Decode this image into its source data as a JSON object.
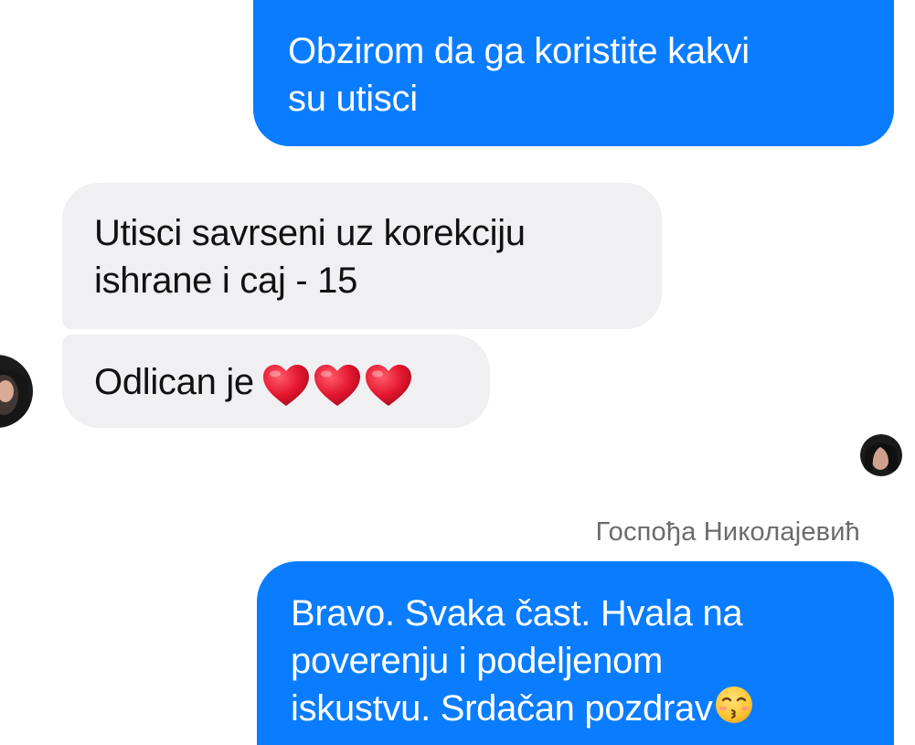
{
  "conversation": {
    "messages": [
      {
        "direction": "outgoing",
        "lines": [
          "Obzirom da ga koristite kakvi",
          "su utisci"
        ]
      },
      {
        "direction": "incoming",
        "lines": [
          "Utisci savrseni uz korekciju",
          "ishrane i caj - 15"
        ]
      },
      {
        "direction": "incoming",
        "text": "Odlican je",
        "emoji": [
          "red-heart-icon",
          "red-heart-icon",
          "red-heart-icon"
        ]
      },
      {
        "direction": "outgoing",
        "lines": [
          "Bravo. Svaka čast. Hvala na",
          "poverenju i podeljenom",
          "iskustvu. Srdačan pozdrav"
        ],
        "trailing_emoji": "kissing-face-icon"
      }
    ],
    "sender_label": "Госпођа Николајевић"
  },
  "colors": {
    "outgoing_bubble": "#0a7cff",
    "incoming_bubble": "#f0f0f3",
    "outgoing_text": "#ffffff",
    "incoming_text": "#111111",
    "sender_label": "#6b6b6b",
    "heart": "#e3162e"
  }
}
